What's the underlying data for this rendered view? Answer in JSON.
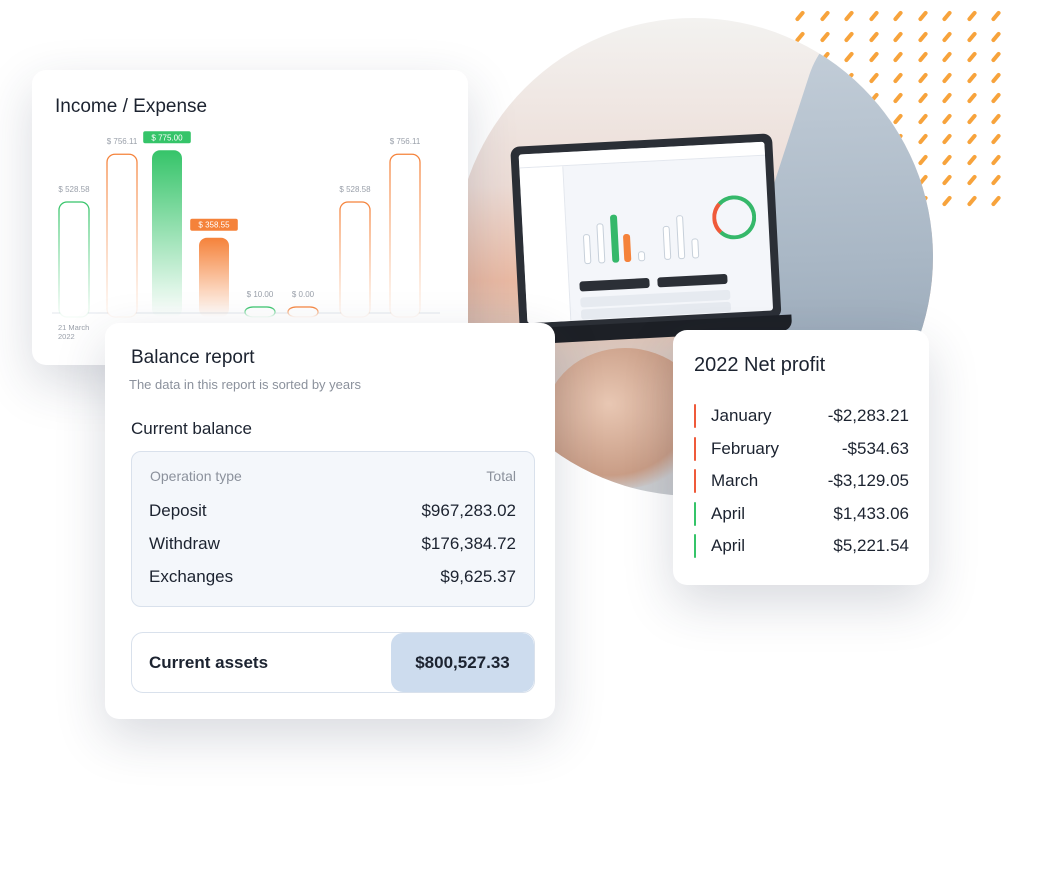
{
  "income_expense": {
    "title": "Income / Expense",
    "date_label_line1": "21 March",
    "date_label_line2": "2022",
    "chart_data": {
      "type": "bar",
      "title": "Income / Expense",
      "xlabel": "",
      "ylabel": "",
      "ylim": [
        0,
        800
      ],
      "bars": [
        {
          "value": 528.58,
          "label": "$ 528.58",
          "style": "outline-green",
          "highlight": false
        },
        {
          "value": 756.11,
          "label": "$ 756.11",
          "style": "outline-orange",
          "highlight": false
        },
        {
          "value": 775.0,
          "label": "$ 775.00",
          "style": "solid-green",
          "highlight": true
        },
        {
          "value": 358.55,
          "label": "$ 358.55",
          "style": "solid-orange",
          "highlight": true
        },
        {
          "value": 10.0,
          "label": "$ 10.00",
          "style": "outline-green",
          "highlight": false
        },
        {
          "value": 0.0,
          "label": "$ 0.00",
          "style": "outline-orange",
          "highlight": false
        },
        {
          "value": 528.58,
          "label": "$ 528.58",
          "style": "outline-orange",
          "highlight": false
        },
        {
          "value": 756.11,
          "label": "$ 756.11",
          "style": "outline-orange",
          "highlight": false
        }
      ],
      "colors": {
        "green": "#35c469",
        "orange": "#f5823a"
      }
    }
  },
  "balance_report": {
    "title": "Balance report",
    "subtitle": "The data in this report is sorted by years",
    "current_balance_label": "Current balance",
    "table": {
      "header_type": "Operation type",
      "header_total": "Total",
      "rows": [
        {
          "type": "Deposit",
          "total": "$967,283.02"
        },
        {
          "type": "Withdraw",
          "total": "$176,384.72"
        },
        {
          "type": "Exchanges",
          "total": "$9,625.37"
        }
      ]
    },
    "current_assets_label": "Current assets",
    "current_assets_value": "$800,527.33"
  },
  "net_profit": {
    "title": "2022 Net profit",
    "rows": [
      {
        "month": "January",
        "value": "-$2,283.21",
        "color": "#ef5a3a"
      },
      {
        "month": "February",
        "value": "-$534.63",
        "color": "#ef5a3a"
      },
      {
        "month": "March",
        "value": "-$3,129.05",
        "color": "#ef5a3a"
      },
      {
        "month": "April",
        "value": "$1,433.06",
        "color": "#35c469"
      },
      {
        "month": "April",
        "value": "$5,221.54",
        "color": "#35c469"
      }
    ]
  },
  "colors": {
    "accent_orange": "#f7a33c",
    "assets_highlight": "#cddcee"
  }
}
